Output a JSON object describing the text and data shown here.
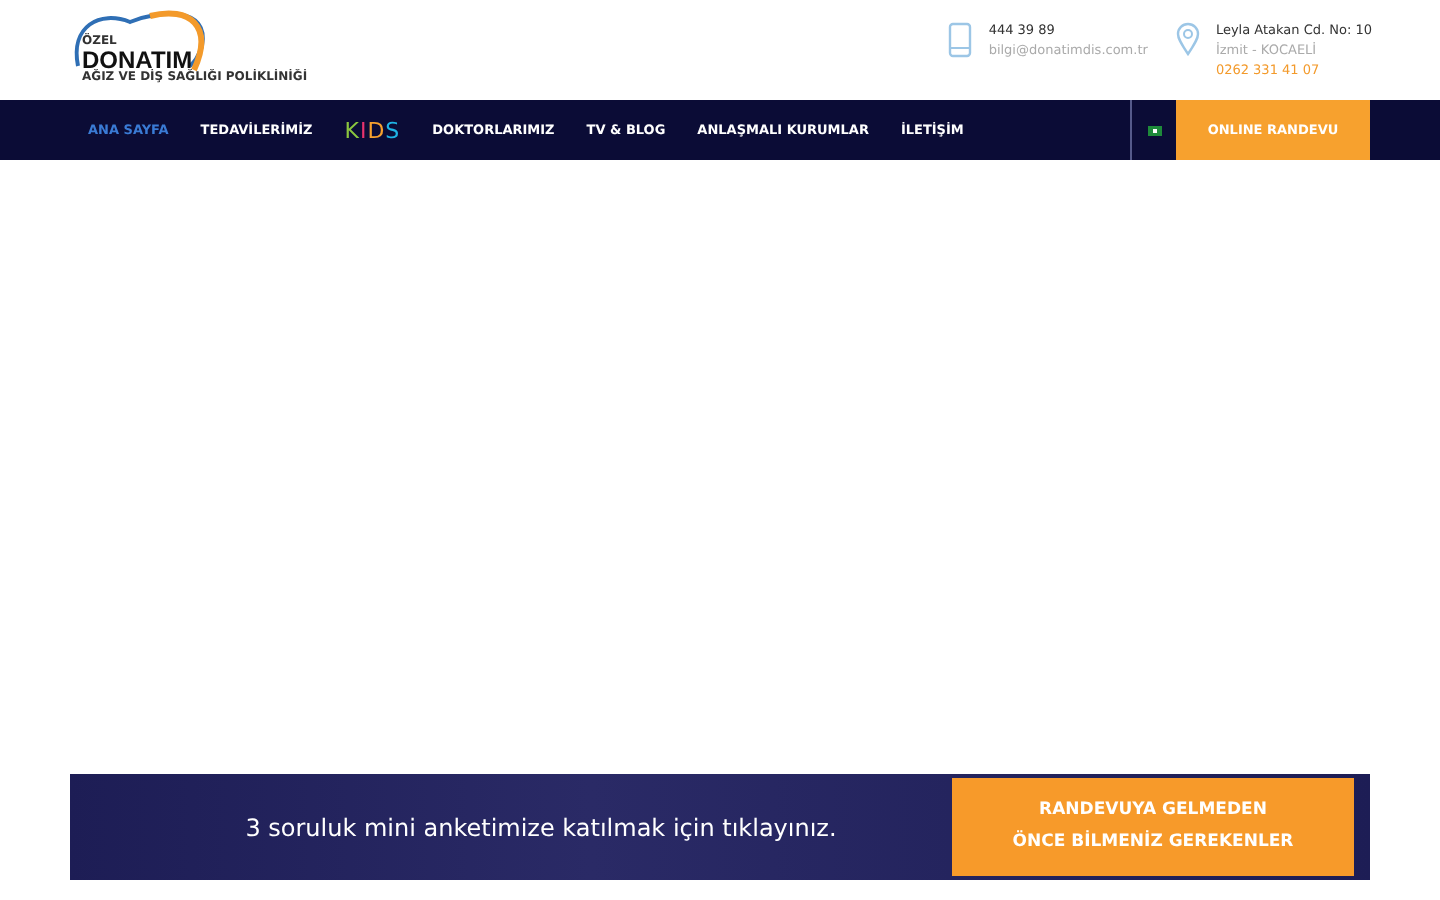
{
  "logo": {
    "prefix": "ÖZEL",
    "name": "DONATIM",
    "tagline": "AĞIZ VE DİŞ SAĞLIĞI POLİKLİNİĞİ"
  },
  "contact": {
    "phone": "444 39 89",
    "email": "bilgi@donatimdis.com.tr",
    "address": "Leyla Atakan Cd. No: 10",
    "city": "İzmit - KOCAELİ",
    "phone_2": "0262 331 41 07"
  },
  "nav": [
    {
      "label": "ANA SAYFA",
      "selected": true,
      "kind": "text"
    },
    {
      "label": "TEDAVİLERİMİZ",
      "selected": false,
      "kind": "text"
    },
    {
      "label": "KIDS",
      "selected": false,
      "kind": "kids"
    },
    {
      "label": "DOKTORLARIMIZ",
      "selected": false,
      "kind": "text"
    },
    {
      "label": "TV & BLOG",
      "selected": false,
      "kind": "text"
    },
    {
      "label": "ANLAŞMALI KURUMLAR",
      "selected": false,
      "kind": "text"
    },
    {
      "label": "İLETİŞİM",
      "selected": false,
      "kind": "text"
    }
  ],
  "appointment_button": "ONLINE RANDEVU",
  "banner": {
    "text": "3 soruluk mini anketimize katılmak için tıklayınız.",
    "button": "RANDEVUYA GELMEDEN ÖNCE BİLMENİZ GEREKENLER"
  }
}
